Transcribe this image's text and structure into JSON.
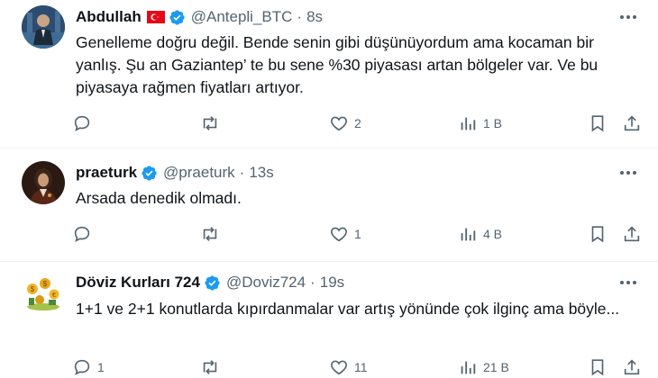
{
  "tweets": [
    {
      "name": "Abdullah",
      "handle": "@Antepli_BTC",
      "separator": "·",
      "time": "8s",
      "text": "Genelleme doğru değil. Bende senin gibi düşünüyordum ama kocaman bir yanlış. Şu an Gaziantep’ te bu sene %30 piyasası artan bölgeler var. Ve bu piyasaya rağmen fiyatları artıyor.",
      "replies": "",
      "retweets": "",
      "likes": "2",
      "views": "1 B"
    },
    {
      "name": "praeturk",
      "handle": "@praeturk",
      "separator": "·",
      "time": "13s",
      "text": "Arsada denedik olmadı.",
      "replies": "",
      "retweets": "",
      "likes": "1",
      "views": "4 B"
    },
    {
      "name": "Döviz Kurları 724",
      "handle": "@Doviz724",
      "separator": "·",
      "time": "19s",
      "text": "1+1 ve 2+1 konutlarda kıpırdanmalar var artış yönünde çok ilginç ama böyle...",
      "replies": "1",
      "retweets": "",
      "likes": "11",
      "views": "21 B"
    }
  ],
  "icons": {
    "verified": "verified-badge-icon",
    "flag": "turkey-flag-icon",
    "more": "more-icon",
    "reply": "reply-icon",
    "retweet": "retweet-icon",
    "like": "like-icon",
    "views": "views-icon",
    "bookmark": "bookmark-icon",
    "share": "share-icon"
  },
  "colors": {
    "verified": "#1d9bf0",
    "secondary_text": "#536471",
    "divider": "#eff3f4"
  }
}
